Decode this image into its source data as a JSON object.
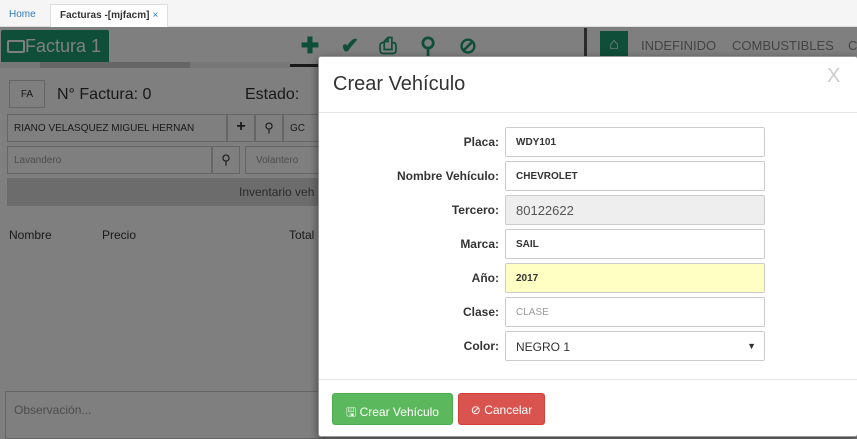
{
  "tabs": {
    "home": "Home",
    "facturas": "Facturas -[mjfacm]",
    "close": "×"
  },
  "toolbar": {
    "factura_label": "Factura 1",
    "icons": [
      "plus-icon",
      "check-icon",
      "print-icon",
      "search-icon",
      "ban-icon"
    ],
    "categories": [
      "INDEFINIDO",
      "COMBUSTIBLES",
      "C"
    ]
  },
  "form": {
    "fa": "FA",
    "nfactura": "N° Factura: 0",
    "estado": "Estado:",
    "cliente": "RIANO VELASQUEZ MIGUEL HERNAN",
    "gc": "GC",
    "lavandero_placeholder": "Lavandero",
    "volantero_placeholder": "Volantero",
    "inventario": "Inventario veh",
    "columns": [
      "Nombre",
      "Precio",
      "Total"
    ],
    "observacion_placeholder": "Observación..."
  },
  "modal": {
    "title": "Crear Vehículo",
    "close": "X",
    "fields": [
      {
        "label": "Placa:",
        "value": "WDY101"
      },
      {
        "label": "Nombre Vehículo:",
        "value": "CHEVROLET"
      },
      {
        "label": "Tercero:",
        "value": "80122622"
      },
      {
        "label": "Marca:",
        "value": "SAIL"
      },
      {
        "label": "Año:",
        "value": "2017"
      },
      {
        "label": "Clase:",
        "placeholder": "CLASE"
      },
      {
        "label": "Color:",
        "value": "NEGRO 1"
      }
    ],
    "buttons": {
      "crear": "Crear Vehículo",
      "cancelar": "Cancelar"
    }
  },
  "colors": {
    "accent": "#1e9e74",
    "success": "#5cb85c",
    "danger": "#d9534f",
    "highlight": "#ffffc4"
  }
}
